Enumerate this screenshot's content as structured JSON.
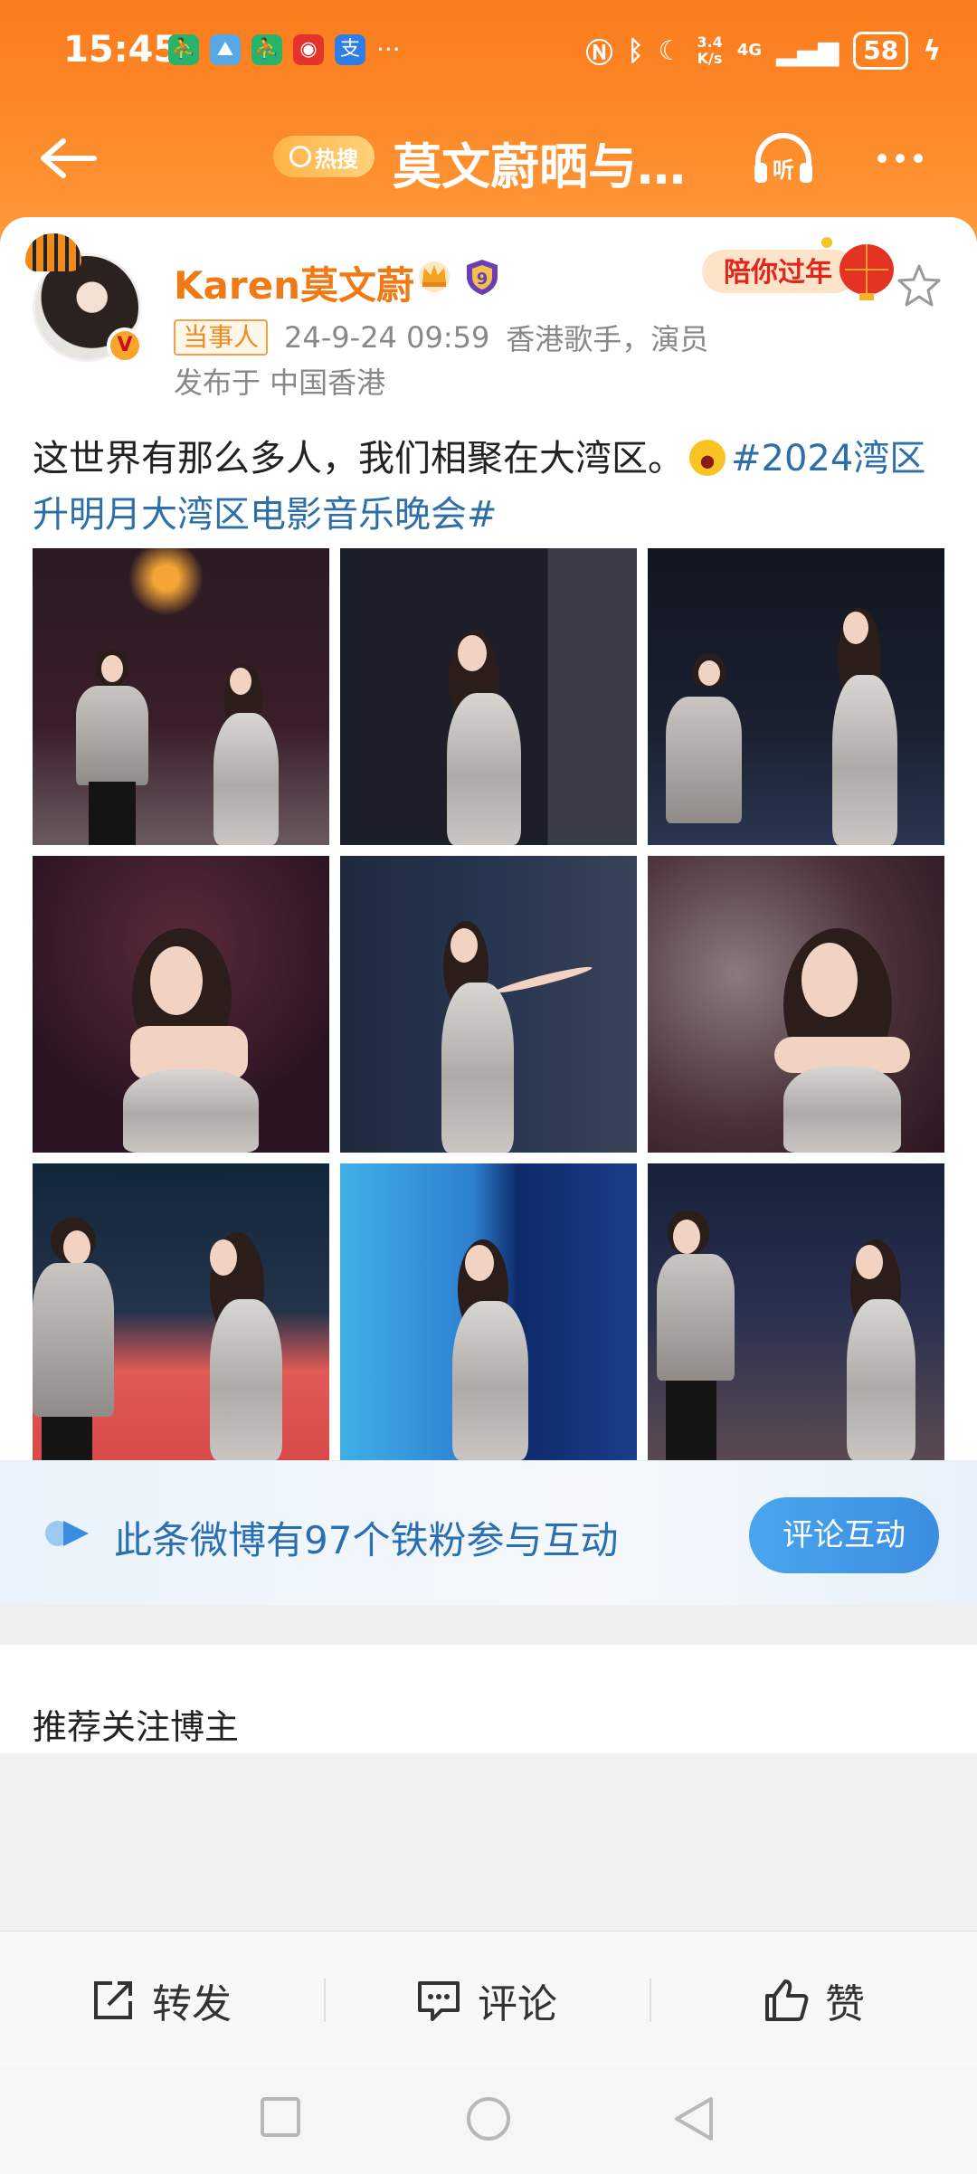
{
  "status_bar": {
    "time": "15:45",
    "speed_value": "3.4",
    "speed_unit": "K/s",
    "network": "4G",
    "battery": "58"
  },
  "nav": {
    "hot_badge": "热搜",
    "title": "莫文蔚晒与…",
    "listen_label": "听"
  },
  "post": {
    "author": "Karen莫文蔚",
    "author_tag": "当事人",
    "timestamp": "24-9-24 09:59",
    "author_title": "香港歌手，演员",
    "location": "发布于 中国香港",
    "text": "这世界有那么多人，我们相聚在大湾区。",
    "hashtag": "#2024湾区升明月大湾区电影音乐晚会#",
    "festive_badge": "陪你过年"
  },
  "fan_bar": {
    "text": "此条微博有97个铁粉参与互动",
    "button": "评论互动"
  },
  "recommend": {
    "title": "推荐关注博主"
  },
  "actions": {
    "repost": "转发",
    "comment": "评论",
    "like": "赞"
  },
  "colors": {
    "header_orange": "#fb7b1d",
    "username_orange": "#f07a16",
    "hashtag_blue": "#2d6fa8",
    "fan_button_blue": "#3b8de0"
  },
  "icons": [
    "back-arrow-icon",
    "search-icon",
    "listen-icon",
    "more-icon",
    "crown-icon",
    "shield-badge-icon",
    "star-icon",
    "wechat-icon",
    "moments-icon",
    "save-image-icon",
    "repost-icon",
    "comment-icon",
    "like-icon",
    "square-nav-icon",
    "circle-nav-icon",
    "triangle-back-nav-icon"
  ]
}
